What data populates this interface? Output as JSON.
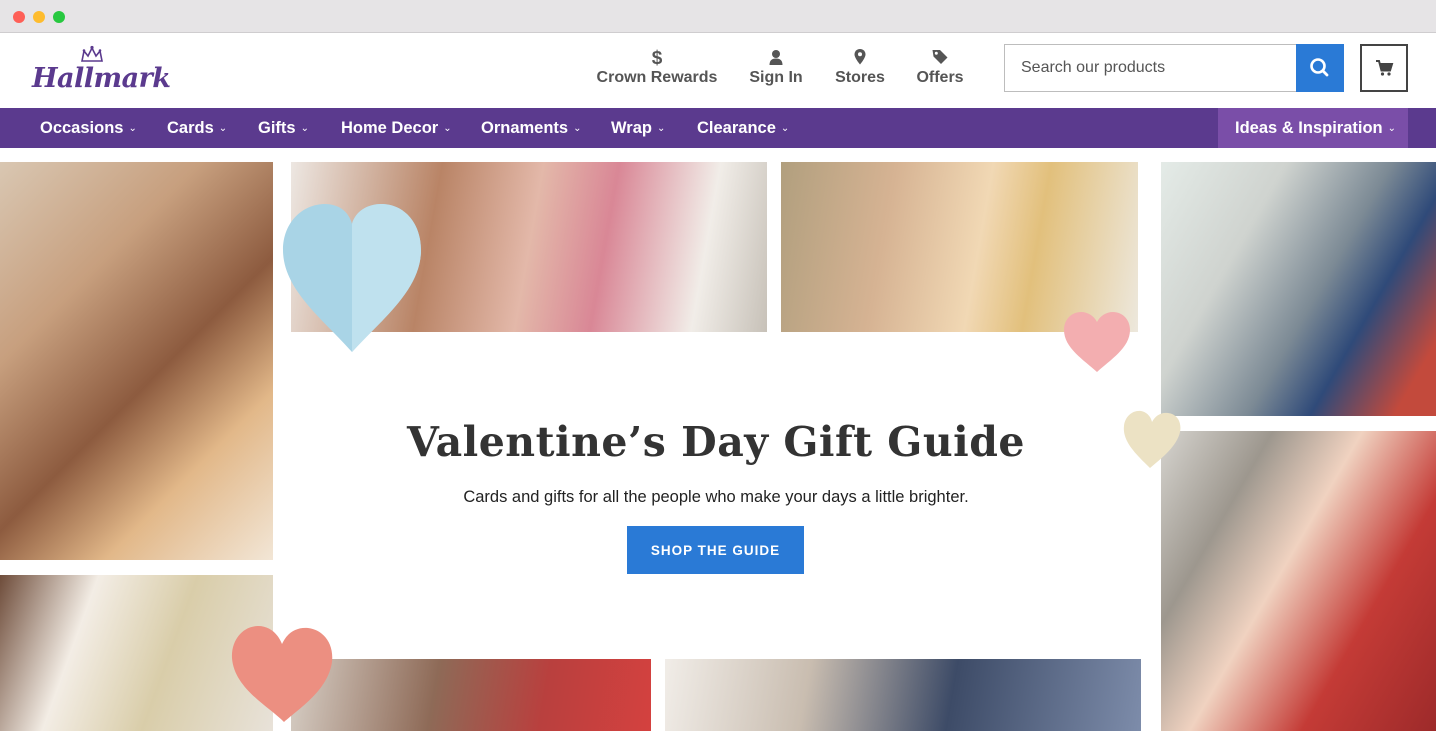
{
  "header": {
    "logo_text": "Hallmark",
    "utility_links": [
      {
        "label": "Crown Rewards",
        "icon": "dollar-icon"
      },
      {
        "label": "Sign In",
        "icon": "person-icon"
      },
      {
        "label": "Stores",
        "icon": "map-pin-icon"
      },
      {
        "label": "Offers",
        "icon": "tag-icon"
      }
    ],
    "search": {
      "placeholder": "Search our products",
      "value": ""
    },
    "cart_icon": "cart-icon"
  },
  "nav": {
    "items": [
      {
        "label": "Occasions"
      },
      {
        "label": "Cards"
      },
      {
        "label": "Gifts"
      },
      {
        "label": "Home Decor"
      },
      {
        "label": "Ornaments"
      },
      {
        "label": "Wrap"
      },
      {
        "label": "Clearance"
      }
    ],
    "ideas": {
      "label": "Ideas & Inspiration"
    },
    "chevron": "⌄"
  },
  "hero": {
    "title": "Valentine’s Day Gift Guide",
    "subtitle": "Cards and gifts for all the people who make your days a little brighter.",
    "cta_label": "SHOP THE GUIDE"
  },
  "colors": {
    "brand_purple": "#5b3a8e",
    "ideas_purple": "#7a4ea8",
    "accent_blue": "#2a7ad6"
  }
}
